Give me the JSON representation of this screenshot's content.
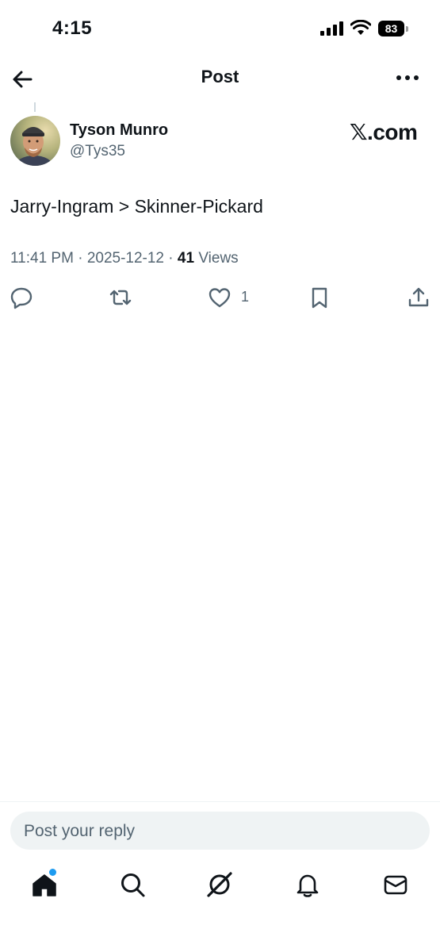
{
  "status_bar": {
    "time": "4:15",
    "battery": "83",
    "icons": [
      "signal-icon",
      "wifi-icon",
      "battery-icon"
    ]
  },
  "header": {
    "title": "Post",
    "back_icon": "arrow-left-icon",
    "more_icon": "more-horizontal-icon"
  },
  "post": {
    "author_name": "Tyson Munro",
    "author_handle": "@Tys35",
    "brand": "𝕏.com",
    "text": "Jarry-Ingram > Skinner-Pickard",
    "time": "11:41 PM",
    "date": "2025-12-12",
    "views_count": "41",
    "views_label": "Views",
    "separator": "·",
    "likes_count": "1"
  },
  "actions": [
    "reply-icon",
    "retweet-icon",
    "like-icon",
    "bookmark-icon",
    "share-icon"
  ],
  "reply": {
    "placeholder": "Post your reply"
  },
  "nav": {
    "items": [
      "home-icon",
      "search-icon",
      "grok-icon",
      "notifications-icon",
      "messages-icon"
    ],
    "accent": "#1d9bf0"
  },
  "colors": {
    "text": "#0f1419",
    "secondary": "#536471",
    "accent": "#1d9bf0",
    "input_bg": "#eff3f4"
  }
}
